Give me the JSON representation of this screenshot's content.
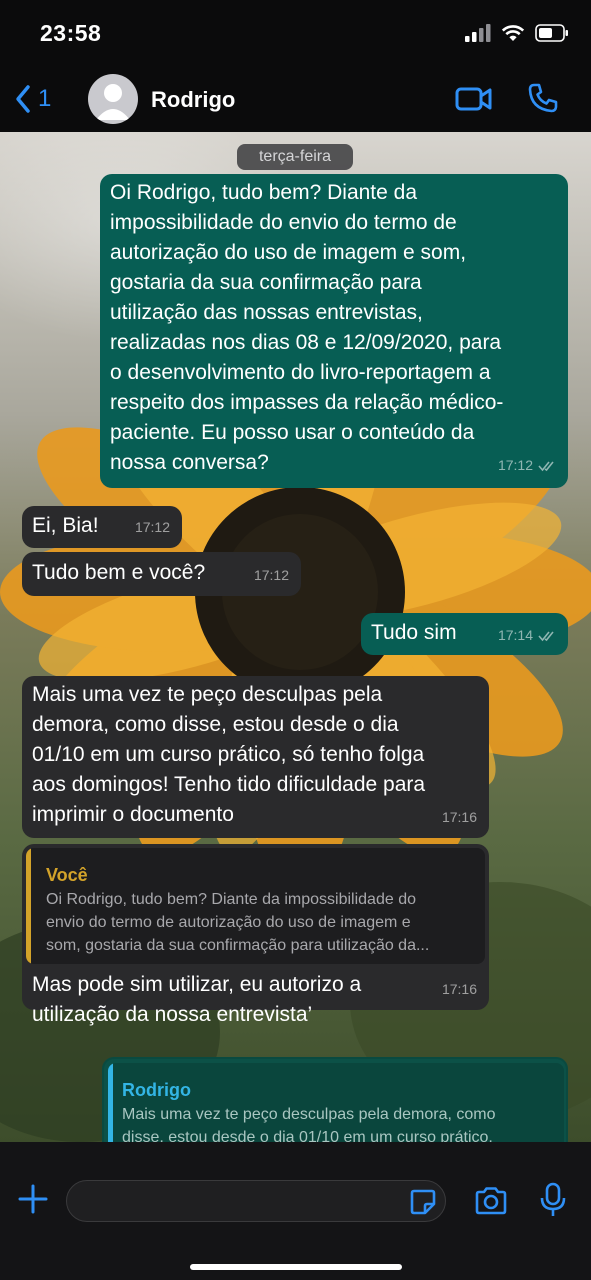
{
  "status_bar": {
    "time": "23:58"
  },
  "header": {
    "back_count": "1",
    "contact_name": "Rodrigo"
  },
  "chat": {
    "date_separator": "terça-feira",
    "messages": [
      {
        "direction": "outgoing",
        "text": "Oi Rodrigo, tudo bem? Diante da\nimpossibilidade do envio do termo de\nautorização do uso de imagem e som,\ngostaria da sua confirmação para\nutilização das nossas entrevistas,\nrealizadas nos dias 08 e 12/09/2020, para\no desenvolvimento do livro-reportagem a\nrespeito dos impasses da relação médico-\npaciente. Eu posso usar o conteúdo da\nnossa conversa?",
        "time": "17:12",
        "status": "read"
      },
      {
        "direction": "incoming",
        "text": "Ei, Bia!",
        "time": "17:12"
      },
      {
        "direction": "incoming",
        "text": "Tudo bem e você?",
        "time": "17:12"
      },
      {
        "direction": "outgoing",
        "text": "Tudo sim",
        "time": "17:14",
        "status": "read"
      },
      {
        "direction": "incoming",
        "text": "Mais uma vez te peço desculpas pela\ndemora, como disse, estou desde o dia\n01/10 em um curso prático, só tenho folga\naos domingos! Tenho tido dificuldade para\nimprimir o documento",
        "time": "17:16"
      },
      {
        "direction": "incoming",
        "reply_to": {
          "author": "Você",
          "text": "Oi Rodrigo, tudo bem? Diante da impossibilidade do\nenvio do termo de autorização do uso de imagem e\nsom, gostaria da sua confirmação para utilização da..."
        },
        "text": "Mas pode sim utilizar, eu autorizo a\nutilização da nossa entrevista’",
        "time": "17:16"
      },
      {
        "direction": "outgoing",
        "reply_to": {
          "author": "Rodrigo",
          "text": "Mais uma vez te peço desculpas pela demora, como\ndisse, estou desde o dia 01/10 em um curso prático,\nsó tenho folga aos domingos! Tenho tido dificuldade..."
        }
      }
    ]
  },
  "colors": {
    "accent": "#2f8ff5",
    "outgoing_bubble": "#075e54",
    "incoming_bubble": "#2a2a2c",
    "quote_author_self": "#d3a32a",
    "quote_author_contact": "#33b5e5"
  },
  "icons": {
    "back": "chevron-left-icon",
    "video": "video-camera-icon",
    "call": "phone-icon",
    "plus": "plus-icon",
    "sticker": "sticker-icon",
    "camera": "camera-icon",
    "mic": "microphone-icon"
  }
}
